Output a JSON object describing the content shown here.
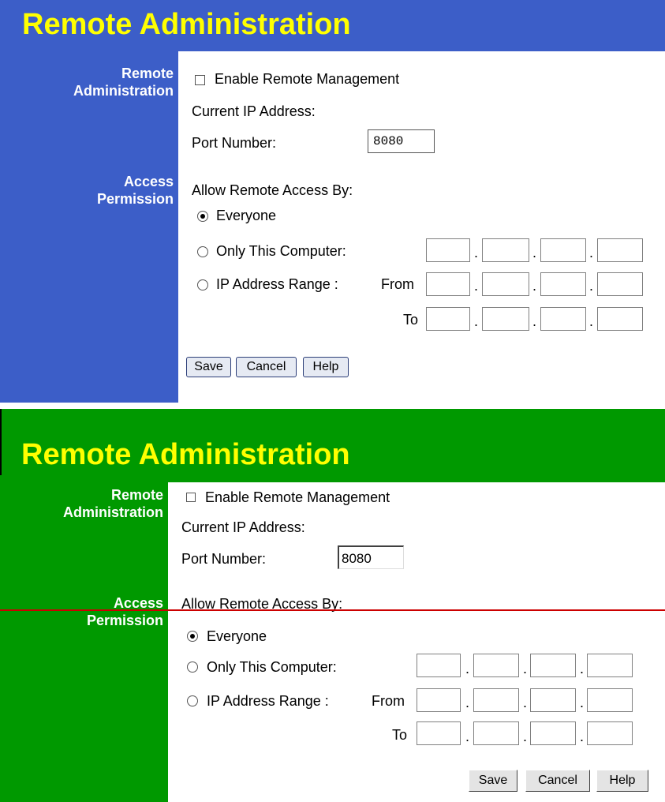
{
  "colors": {
    "panel_a_bar": "#3c5ec8",
    "panel_b_bar": "#009900",
    "title_text": "#ffff00",
    "divider": "#cc0000"
  },
  "title": "Remote Administration",
  "sections": {
    "remote_admin_line1": "Remote",
    "remote_admin_line2": "Administration",
    "access_line1": "Access",
    "access_line2": "Permission"
  },
  "fields": {
    "enable_remote_label": "Enable Remote Management",
    "enable_remote_checked": false,
    "current_ip_label": "Current IP Address:",
    "port_label": "Port Number:",
    "port_value": "8080",
    "allow_label": "Allow Remote Access By:",
    "everyone_label": "Everyone",
    "only_this_label": "Only This Computer:",
    "ip_range_label": "IP Address Range :",
    "from_label": "From",
    "to_label": "To",
    "selected_access": "Everyone",
    "ip_dot": "."
  },
  "buttons": {
    "save": "Save",
    "cancel": "Cancel",
    "help": "Help"
  }
}
